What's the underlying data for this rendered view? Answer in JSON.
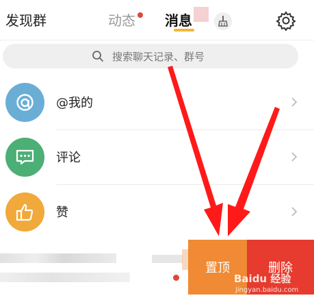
{
  "header": {
    "discover_label": "发现群",
    "tabs": [
      {
        "label": "动态",
        "has_badge": true,
        "selected": false
      },
      {
        "label": "消息",
        "has_badge": false,
        "selected": true
      }
    ],
    "icons": [
      "broom-icon",
      "gear-icon"
    ]
  },
  "search": {
    "placeholder": "搜索聊天记录、群号",
    "icon": "search-icon"
  },
  "rows": [
    {
      "label": "@我的",
      "icon": "at-icon",
      "color": "#6aaed6"
    },
    {
      "label": "评论",
      "icon": "comment-icon",
      "color": "#4caf76"
    },
    {
      "label": "赞",
      "icon": "thumbs-up-icon",
      "color": "#f0a93a"
    }
  ],
  "swipe_row": {
    "pin_label": "置顶",
    "delete_label": "删除",
    "unread": true
  },
  "watermark": {
    "main": "Baidu 经验",
    "sub": "jingyan.baidu.com"
  },
  "colors": {
    "accent": "#f2b732",
    "badge": "#e0463a",
    "pin": "#f08a34",
    "delete": "#e63b2e",
    "annotation_arrow": "#ff1a1a"
  }
}
